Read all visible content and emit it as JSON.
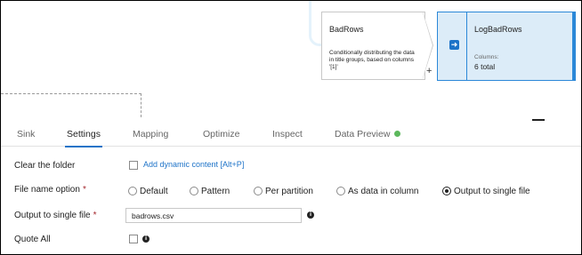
{
  "canvas": {
    "source_node": {
      "title": "BadRows",
      "description": "Conditionally distributing the data in title groups, based on columns '[1]'"
    },
    "sink_node": {
      "title": "LogBadRows",
      "columns_label": "Columns:",
      "columns_value": "6 total"
    },
    "add_glyph": "+"
  },
  "tabs": [
    {
      "label": "Sink"
    },
    {
      "label": "Settings",
      "active": true
    },
    {
      "label": "Mapping"
    },
    {
      "label": "Optimize"
    },
    {
      "label": "Inspect"
    },
    {
      "label": "Data Preview",
      "status_color": "#5cb85c"
    }
  ],
  "form": {
    "clear_folder": {
      "label": "Clear the folder",
      "checked": false,
      "link": "Add dynamic content [Alt+P]"
    },
    "file_name_option": {
      "label": "File name option",
      "required": "*",
      "options": [
        "Default",
        "Pattern",
        "Per partition",
        "As data in column",
        "Output to single file"
      ],
      "selected": "Output to single file"
    },
    "output_single_file": {
      "label": "Output to single file",
      "required": "*",
      "value": "badrows.csv"
    },
    "quote_all": {
      "label": "Quote All",
      "checked": false
    }
  },
  "icons": {
    "sink": "sink-arrow-icon",
    "info": "info-icon",
    "minimize": "minimize-icon"
  },
  "colors": {
    "accent": "#1e73c8",
    "node_selected_bg": "#dcecf8",
    "required": "#a4262c",
    "status_ok": "#5cb85c"
  }
}
